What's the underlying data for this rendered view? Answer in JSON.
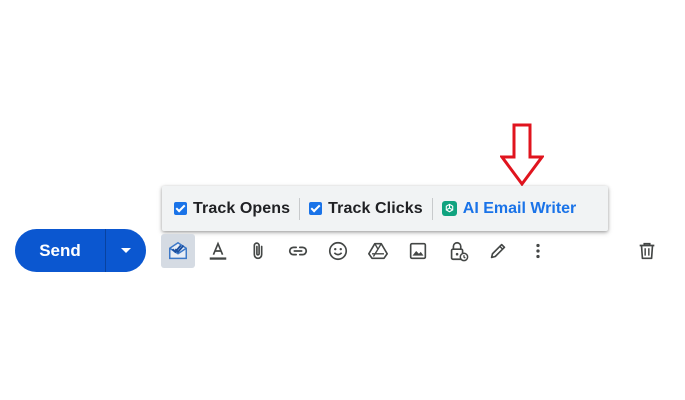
{
  "extension_bar": {
    "track_opens_label": "Track Opens",
    "track_opens_checked": true,
    "track_clicks_label": "Track Clicks",
    "track_clicks_checked": true,
    "ai_writer_label": "AI Email Writer"
  },
  "compose": {
    "send_label": "Send"
  },
  "toolbar_icons": [
    "mailtrack-icon",
    "text-format-icon",
    "attachment-icon",
    "link-icon",
    "emoji-icon",
    "drive-icon",
    "photo-icon",
    "confidential-mode-icon",
    "signature-icon",
    "more-options-icon",
    "delete-icon"
  ],
  "colors": {
    "send_button": "#0b57d0",
    "checkbox": "#1a73e8",
    "ai_link": "#1a73e8",
    "annotation_arrow": "#e0141e",
    "active_tool_bg": "#d5dbe3"
  }
}
